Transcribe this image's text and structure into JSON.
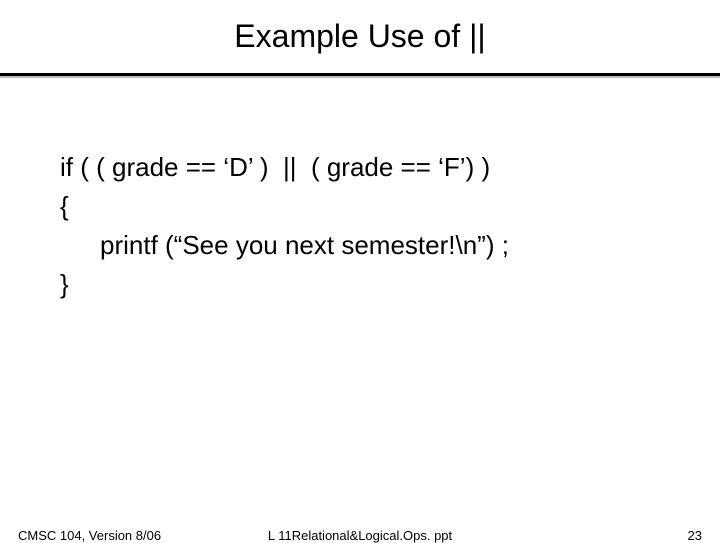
{
  "slide": {
    "title": "Example Use of ||",
    "code": {
      "line1": "if ( ( grade == ‘D’ )  ||  ( grade == ‘F’) )",
      "line2": "{",
      "line3": "printf (“See you next semester!\\n”) ;",
      "line4": "}"
    },
    "footer": {
      "left": "CMSC 104, Version 8/06",
      "center": "L 11Relational&Logical.Ops. ppt",
      "right": "23"
    }
  }
}
